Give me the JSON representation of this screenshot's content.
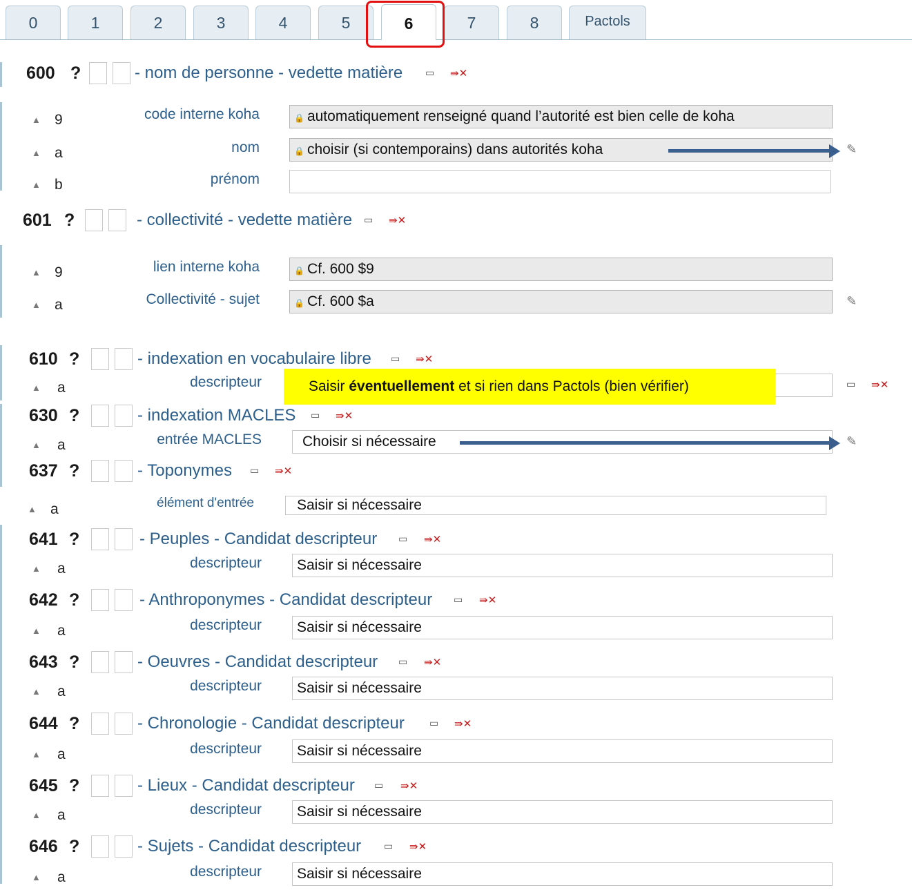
{
  "tabs": {
    "items": [
      "0",
      "1",
      "2",
      "3",
      "4",
      "5",
      "6",
      "7",
      "8",
      "Pactols"
    ],
    "active": "6"
  },
  "icons": {
    "repeat": "repeat-field-icon",
    "delete": "delete-field-icon",
    "edit": "edit-authority-icon",
    "lock": "lock-icon",
    "collapse": "collapse-triangle-icon"
  },
  "fields": {
    "f600": {
      "tag": "600",
      "q": "?",
      "title": "- nom de personne - vedette matière"
    },
    "f601": {
      "tag": "601",
      "q": "?",
      "title": "- collectivité - vedette matière"
    },
    "f610": {
      "tag": "610",
      "q": "?",
      "title": "- indexation en vocabulaire libre"
    },
    "f630": {
      "tag": "630",
      "q": "?",
      "title": "- indexation MACLES"
    },
    "f637": {
      "tag": "637",
      "q": "?",
      "title": "- Toponymes"
    },
    "f641": {
      "tag": "641",
      "q": "?",
      "title": "- Peuples - Candidat descripteur"
    },
    "f642": {
      "tag": "642",
      "q": "?",
      "title": "- Anthroponymes - Candidat descripteur"
    },
    "f643": {
      "tag": "643",
      "q": "?",
      "title": "- Oeuvres - Candidat descripteur"
    },
    "f644": {
      "tag": "644",
      "q": "?",
      "title": "- Chronologie - Candidat descripteur"
    },
    "f645": {
      "tag": "645",
      "q": "?",
      "title": "- Lieux - Candidat descripteur"
    },
    "f646": {
      "tag": "646",
      "q": "?",
      "title": "- Sujets - Candidat descripteur"
    }
  },
  "subfields": {
    "s600_9": {
      "code": "9",
      "label": "code interne koha",
      "value": "automatiquement renseigné quand l’autorité est bien celle de koha"
    },
    "s600_a": {
      "code": "a",
      "label": "nom",
      "value": "choisir (si contemporains) dans autorités koha"
    },
    "s600_b": {
      "code": "b",
      "label": "prénom",
      "value": ""
    },
    "s601_9": {
      "code": "9",
      "label": "lien interne koha",
      "value": "Cf. 600 $9"
    },
    "s601_a": {
      "code": "a",
      "label": "Collectivité - sujet",
      "value": "Cf. 600 $a"
    },
    "s610_a": {
      "code": "a",
      "label": "descripteur",
      "value": ""
    },
    "s630_a": {
      "code": "a",
      "label": "entrée MACLES",
      "value": "Choisir si nécessaire"
    },
    "s637_a": {
      "code": "a",
      "label": "élément d'entrée",
      "value": "Saisir si nécessaire"
    },
    "s641_a": {
      "code": "a",
      "label": "descripteur",
      "value": "Saisir si nécessaire"
    },
    "s642_a": {
      "code": "a",
      "label": "descripteur",
      "value": "Saisir si nécessaire"
    },
    "s643_a": {
      "code": "a",
      "label": "descripteur",
      "value": "Saisir si nécessaire"
    },
    "s644_a": {
      "code": "a",
      "label": "descripteur",
      "value": "Saisir si nécessaire"
    },
    "s645_a": {
      "code": "a",
      "label": "descripteur",
      "value": "Saisir si nécessaire"
    },
    "s646_a": {
      "code": "a",
      "label": "descripteur",
      "value": "Saisir si nécessaire"
    }
  },
  "note": {
    "prefix": "Saisir ",
    "bold": "éventuellement",
    "suffix": " et si rien dans Pactols (bien vérifier)"
  },
  "colors": {
    "highlight": "#ffff00",
    "tab_outline": "#e21010",
    "arrow": "#3a5f8e",
    "link": "#2d5f8c"
  }
}
